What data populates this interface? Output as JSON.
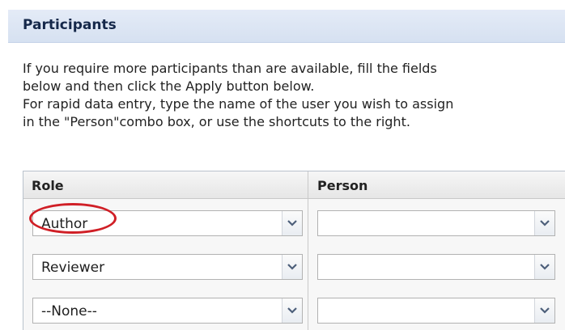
{
  "panel": {
    "title": "Participants"
  },
  "instructions": [
    "If you require more participants than are available, fill the fields",
    "below and then click the Apply button below.",
    "For rapid data entry, type the name of the user you wish to assign",
    "in the \"Person\"combo box, or use the shortcuts to the right."
  ],
  "table": {
    "headers": {
      "role": "Role",
      "person": "Person"
    },
    "rows": [
      {
        "role": "Author",
        "person": ""
      },
      {
        "role": "Reviewer",
        "person": ""
      },
      {
        "role": "--None--",
        "person": ""
      }
    ]
  },
  "annotation": {
    "highlighted_field": "Author",
    "ring_color": "#d01f26"
  }
}
